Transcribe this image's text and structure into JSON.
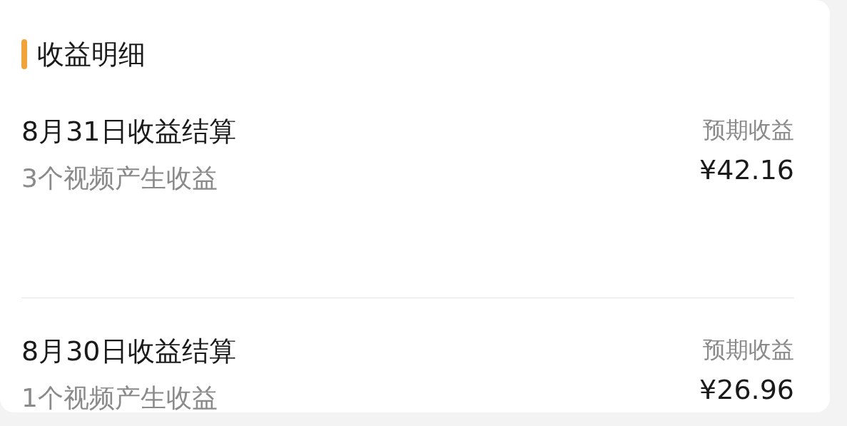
{
  "section": {
    "title": "收益明细"
  },
  "rows": [
    {
      "title": "8月31日收益结算",
      "subtitle": "3个视频产生收益",
      "label": "预期收益",
      "amount": "¥42.16"
    },
    {
      "title": "8月30日收益结算",
      "subtitle": "1个视频产生收益",
      "label": "预期收益",
      "amount": "¥26.96"
    }
  ]
}
